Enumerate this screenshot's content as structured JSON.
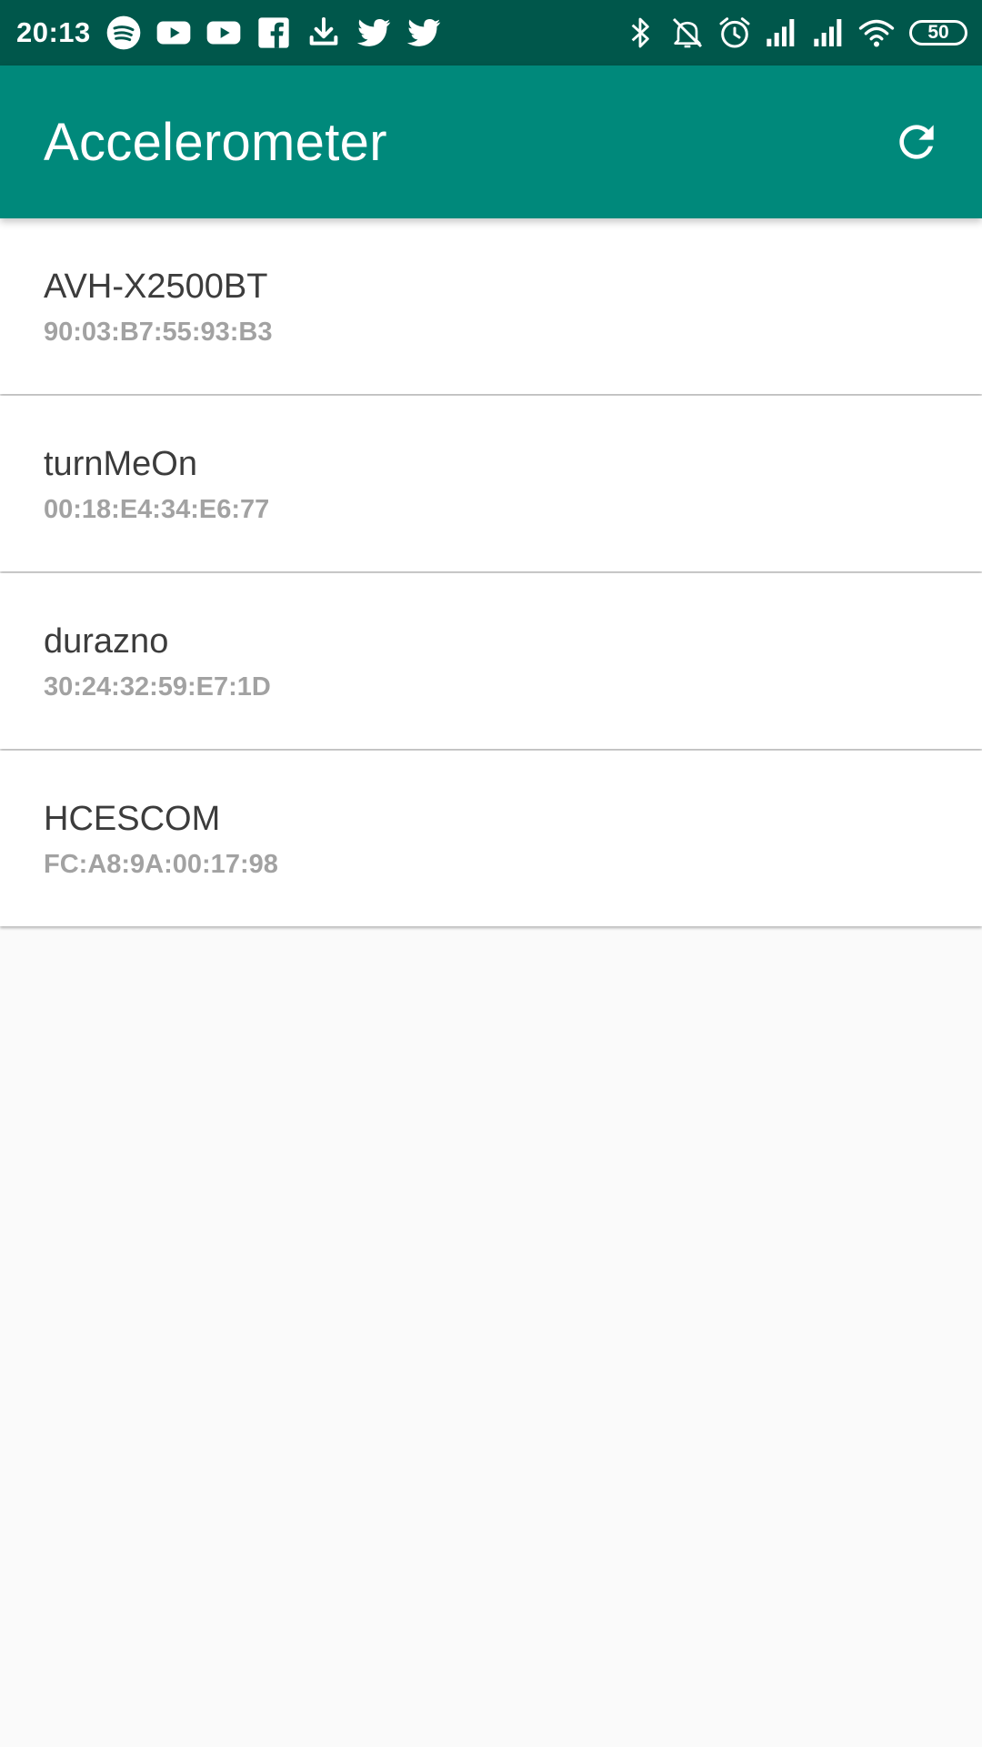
{
  "status_bar": {
    "time": "20:13",
    "notification_icons": [
      "spotify-icon",
      "youtube-icon",
      "youtube-icon",
      "facebook-icon",
      "download-icon",
      "twitter-icon",
      "twitter-icon"
    ],
    "system_icons": [
      "bluetooth-icon",
      "muted-icon",
      "alarm-icon",
      "signal-icon",
      "signal-icon",
      "wifi-icon"
    ],
    "battery": "50"
  },
  "app_bar": {
    "title": "Accelerometer",
    "refresh_icon": "refresh-icon"
  },
  "devices": [
    {
      "name": "AVH-X2500BT",
      "address": "90:03:B7:55:93:B3"
    },
    {
      "name": "turnMeOn",
      "address": "00:18:E4:34:E6:77"
    },
    {
      "name": "durazno",
      "address": "30:24:32:59:E7:1D"
    },
    {
      "name": "HCESCOM",
      "address": "FC:A8:9A:00:17:98"
    }
  ],
  "colors": {
    "status_bar": "#00574b",
    "app_bar": "#00897b",
    "background": "#fafafa"
  }
}
